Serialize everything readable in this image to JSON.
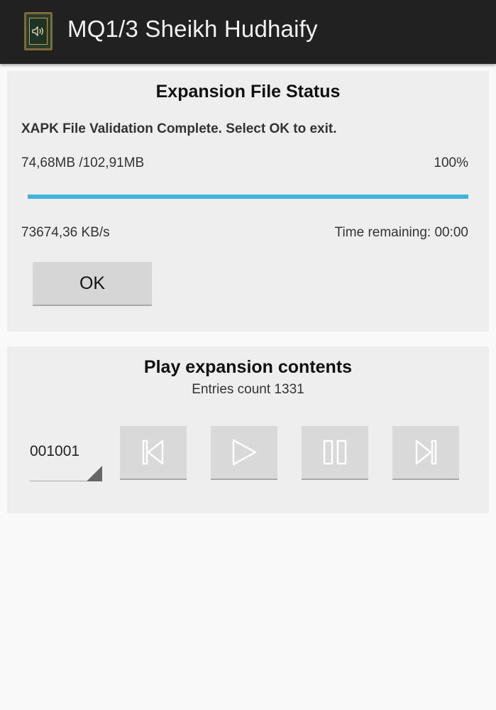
{
  "action_bar": {
    "title": "MQ1/3 Sheikh Hudhaify",
    "icon": "app-speaker-icon"
  },
  "status_card": {
    "title": "Expansion File Status",
    "status_message": "XAPK File Validation Complete. Select OK to exit.",
    "progress_size": "74,68MB /102,91MB",
    "progress_percent": "100%",
    "progress_value": 1.0,
    "speed": "73674,36 KB/s",
    "time_remaining": "Time remaining: 00:00",
    "ok_label": "OK"
  },
  "play_card": {
    "title": "Play expansion contents",
    "entries_count": "Entries count 1331",
    "selected_entry": "001001",
    "controls": [
      {
        "icon": "skip-previous-icon"
      },
      {
        "icon": "play-icon"
      },
      {
        "icon": "pause-icon"
      },
      {
        "icon": "skip-next-icon"
      }
    ]
  },
  "colors": {
    "action_bar_bg": "#212121",
    "progress_fill": "#40b3dc",
    "card_bg": "#eeeeee"
  }
}
